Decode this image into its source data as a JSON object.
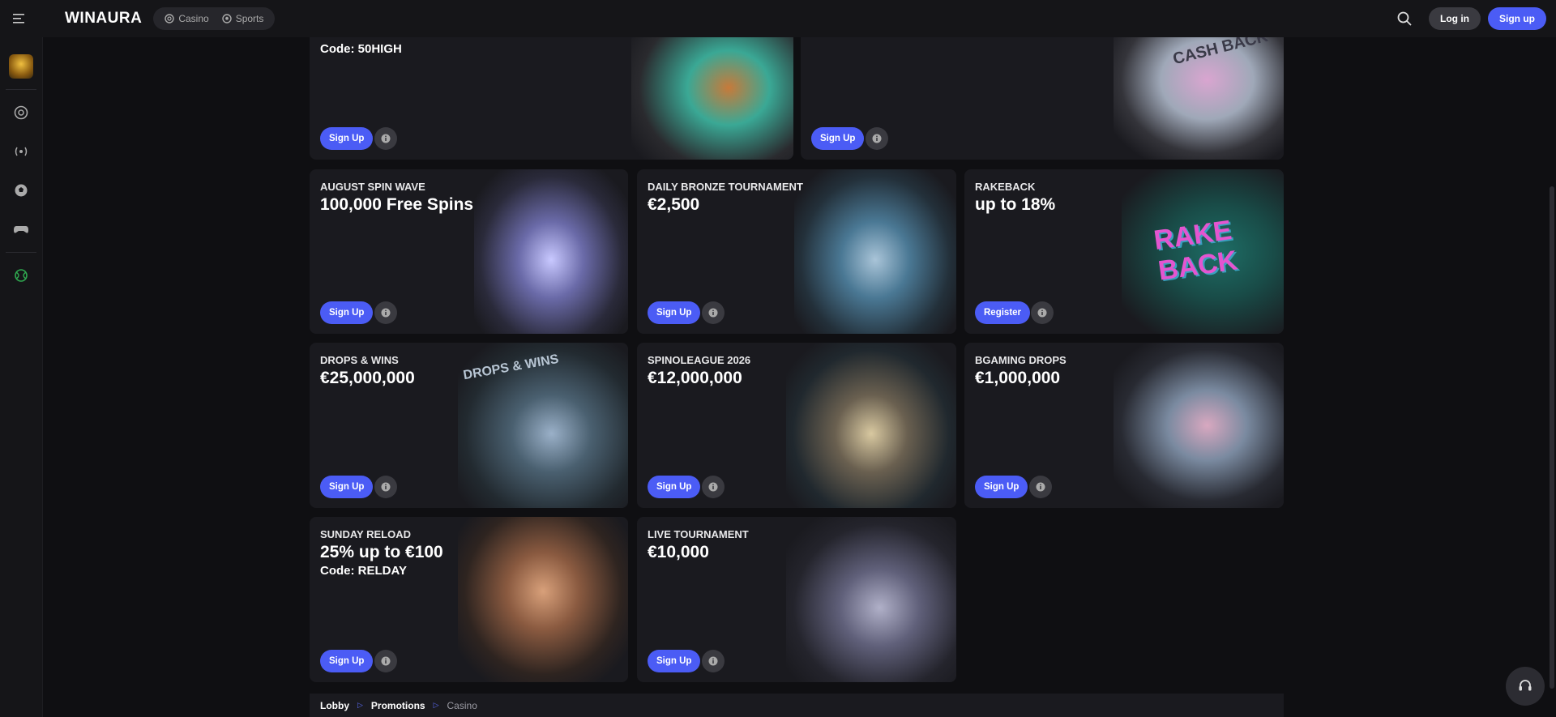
{
  "brand": {
    "logo_text": "WINAURA"
  },
  "header": {
    "categories": [
      {
        "label": "Casino",
        "icon": "casino-chip-icon"
      },
      {
        "label": "Sports",
        "icon": "soccer-ball-icon"
      }
    ],
    "login_label": "Log in",
    "signup_label": "Sign up"
  },
  "rail": {
    "items": [
      "promo-avatar",
      "casino-chip-icon",
      "live-broadcast-icon",
      "soccer-ball-icon",
      "gamepad-icon",
      "tennis-ball-icon"
    ]
  },
  "promos": [
    {
      "subtitle": "",
      "title": "",
      "code": "Code: 50HIGH",
      "button": "Sign Up"
    },
    {
      "subtitle": "",
      "title": "",
      "code": "",
      "button": "Sign Up",
      "art_text": "CASH BACK"
    },
    {
      "subtitle": "AUGUST SPIN WAVE",
      "title": "100,000 Free Spins",
      "code": "",
      "button": "Sign Up"
    },
    {
      "subtitle": "DAILY BRONZE TOURNAMENT",
      "title": "€2,500",
      "code": "",
      "button": "Sign Up"
    },
    {
      "subtitle": "RAKEBACK",
      "title": "up to 18%",
      "code": "",
      "button": "Register",
      "art_text": "RAKE BACK"
    },
    {
      "subtitle": "DROPS & WINS",
      "title": "€25,000,000",
      "code": "",
      "button": "Sign Up",
      "art_text": "DROPS & WINS"
    },
    {
      "subtitle": "SPINOLEAGUE 2026",
      "title": "€12,000,000",
      "code": "",
      "button": "Sign Up"
    },
    {
      "subtitle": "BGAMING DROPS",
      "title": "€1,000,000",
      "code": "",
      "button": "Sign Up"
    },
    {
      "subtitle": "SUNDAY RELOAD",
      "title": "25% up to €100",
      "code": "Code: RELDAY",
      "button": "Sign Up"
    },
    {
      "subtitle": "LIVE TOURNAMENT",
      "title": "€10,000",
      "code": "",
      "button": "Sign Up"
    }
  ],
  "breadcrumb": [
    {
      "label": "Lobby"
    },
    {
      "label": "Promotions"
    },
    {
      "label": "Casino"
    }
  ],
  "colors": {
    "accent": "#4b5cf5",
    "card_bg": "#1a1a1f",
    "page_bg": "#0f0f12"
  }
}
